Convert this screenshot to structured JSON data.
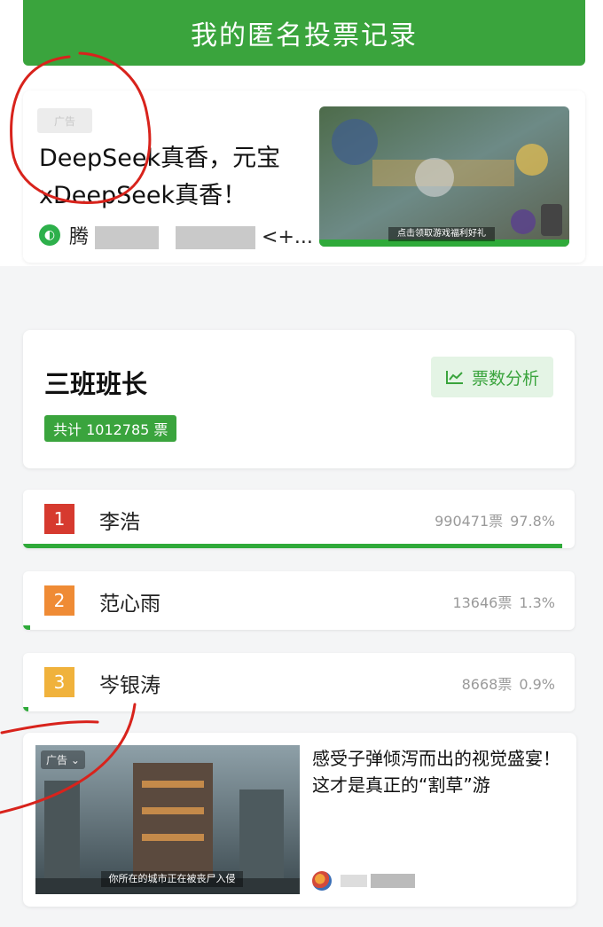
{
  "header": {
    "title": "我的匿名投票记录"
  },
  "ad_top": {
    "tag": "广告",
    "title": "DeepSeek真香，元宝xDeepSeek真香！",
    "source_prefix": "腾",
    "source_suffix": "<+...",
    "thumb_caption": "点击领取游戏福利好礼"
  },
  "poll": {
    "title": "三班班长",
    "analysis_label": "票数分析",
    "total_label": "共计 1012785 票",
    "candidates": [
      {
        "rank": "1",
        "name": "李浩",
        "votes": "990471票",
        "pct": "97.8%",
        "share": 0.978,
        "color": "#d63a2f"
      },
      {
        "rank": "2",
        "name": "范心雨",
        "votes": "13646票",
        "pct": "1.3%",
        "share": 0.013,
        "color": "#ef8b35"
      },
      {
        "rank": "3",
        "name": "岑银涛",
        "votes": "8668票",
        "pct": "0.9%",
        "share": 0.009,
        "color": "#f0b23c"
      }
    ]
  },
  "ad_bottom": {
    "tag": "广告",
    "title": "感受子弹倾泻而出的视觉盛宴！这才是真正的“割草”游",
    "thumb_caption": "你所在的城市正在被丧尸入侵"
  },
  "colors": {
    "brand_green": "#3aa43d",
    "bar_green": "#2faa3a"
  }
}
